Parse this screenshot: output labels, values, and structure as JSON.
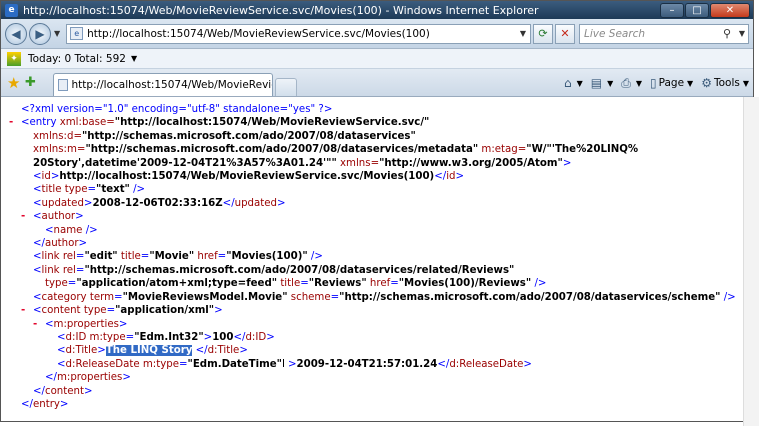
{
  "window": {
    "title": "http://localhost:15074/Web/MovieReviewService.svc/Movies(100) - Windows Internet Explorer"
  },
  "address_bar": {
    "url": "http://localhost:15074/Web/MovieReviewService.svc/Movies(100)"
  },
  "search": {
    "placeholder": "Live Search"
  },
  "info_bar": {
    "text": "Today:  0 Total:  592"
  },
  "tab": {
    "label": "http://localhost:15074/Web/MovieReviewService...."
  },
  "commands": {
    "page": "Page",
    "tools": "Tools"
  },
  "xml": {
    "decl": "<?xml version=\"1.0\" encoding=\"utf-8\" standalone=\"yes\" ?>",
    "entry_open_tag": "<entry",
    "xml_base_attr": " xml:base=",
    "xml_base_val": "\"http://localhost:15074/Web/MovieReviewService.svc/\"",
    "xmlns_d_attr": "xmlns:d=",
    "xmlns_d_val": "\"http://schemas.microsoft.com/ado/2007/08/dataservices\"",
    "xmlns_m_attr": "xmlns:m=",
    "xmlns_m_val": "\"http://schemas.microsoft.com/ado/2007/08/dataservices/metadata\"",
    "etag_attr": " m:etag=",
    "etag_val_1": "\"W/\"'The%20LINQ%",
    "etag_val_2": "20Story',datetime'2009-12-04T21%3A57%3A01.24'\"\"",
    "xmlns_attr": " xmlns=",
    "xmlns_val": "\"http://www.w3.org/2005/Atom\"",
    "id_text": "http://localhost:15074/Web/MovieReviewService.svc/Movies(100)",
    "title_type_val": "\"text\"",
    "updated_text": "2008-12-06T02:33:16Z",
    "link_edit_rel": "\"edit\"",
    "link_edit_title": "\"Movie\"",
    "link_edit_href": "\"Movies(100)\"",
    "link_rel_val": "\"http://schemas.microsoft.com/ado/2007/08/dataservices/related/Reviews\"",
    "link_type_val": "\"application/atom+xml;type=feed\"",
    "link_title_val": "\"Reviews\"",
    "link_href_val": "\"Movies(100)/Reviews\"",
    "category_term_val": "\"MovieReviewsModel.Movie\"",
    "category_scheme_val": "\"http://schemas.microsoft.com/ado/2007/08/dataservices/scheme\"",
    "content_type_val": "\"application/xml\"",
    "id_type_val": "\"Edm.Int32\"",
    "id_value": "100",
    "title_value": "The LINQ Story",
    "date_type_val": "\"Edm.DateTime\"",
    "date_value": "2009-12-04T21:57:01.24"
  }
}
